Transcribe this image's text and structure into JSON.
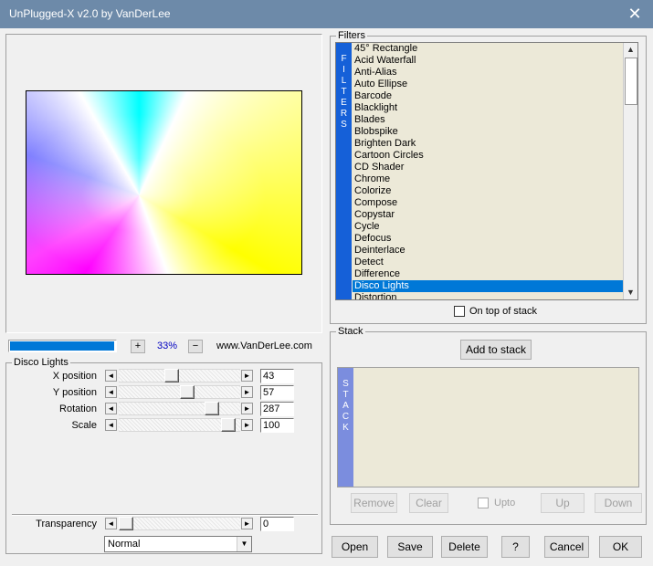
{
  "window": {
    "title": "UnPlugged-X v2.0 by VanDerLee",
    "close": "✕"
  },
  "zoom": {
    "plus": "+",
    "value": "33%",
    "minus": "−"
  },
  "website": "www.VanDerLee.com",
  "effect": {
    "group_label": "Disco Lights",
    "params": [
      {
        "label": "X position",
        "value": "43",
        "fraction": 0.43
      },
      {
        "label": "Y position",
        "value": "57",
        "fraction": 0.57
      },
      {
        "label": "Rotation",
        "value": "287",
        "fraction": 0.8
      },
      {
        "label": "Scale",
        "value": "100",
        "fraction": 0.96
      }
    ],
    "transparency": {
      "label": "Transparency",
      "value": "0",
      "fraction": 0.0
    },
    "blend_mode": {
      "selected": "Normal"
    }
  },
  "filters": {
    "group_label": "Filters",
    "side_label": [
      "F",
      "I",
      "L",
      "T",
      "E",
      "R",
      "S"
    ],
    "items": [
      "45° Rectangle",
      "Acid Waterfall",
      "Anti-Alias",
      "Auto Ellipse",
      "Barcode",
      "Blacklight",
      "Blades",
      "Blobspike",
      "Brighten Dark",
      "Cartoon Circles",
      "CD Shader",
      "Chrome",
      "Colorize",
      "Compose",
      "Copystar",
      "Cycle",
      "Defocus",
      "Deinterlace",
      "Detect",
      "Difference",
      "Disco Lights",
      "Distortion"
    ],
    "selected": "Disco Lights",
    "on_top_label": "On top of stack"
  },
  "stack": {
    "group_label": "Stack",
    "add_label": "Add to stack",
    "side_label": [
      "S",
      "T",
      "A",
      "C",
      "K"
    ],
    "remove_label": "Remove",
    "clear_label": "Clear",
    "upto_label": "Upto",
    "up_label": "Up",
    "down_label": "Down"
  },
  "footer": {
    "open": "Open",
    "save": "Save",
    "delete": "Delete",
    "help": "?",
    "cancel": "Cancel",
    "ok": "OK"
  },
  "colors": {
    "titlebar": "#6d8aa9",
    "selection": "#0078d7",
    "side_bar": "#1560d8",
    "progress": "#0078d7"
  }
}
